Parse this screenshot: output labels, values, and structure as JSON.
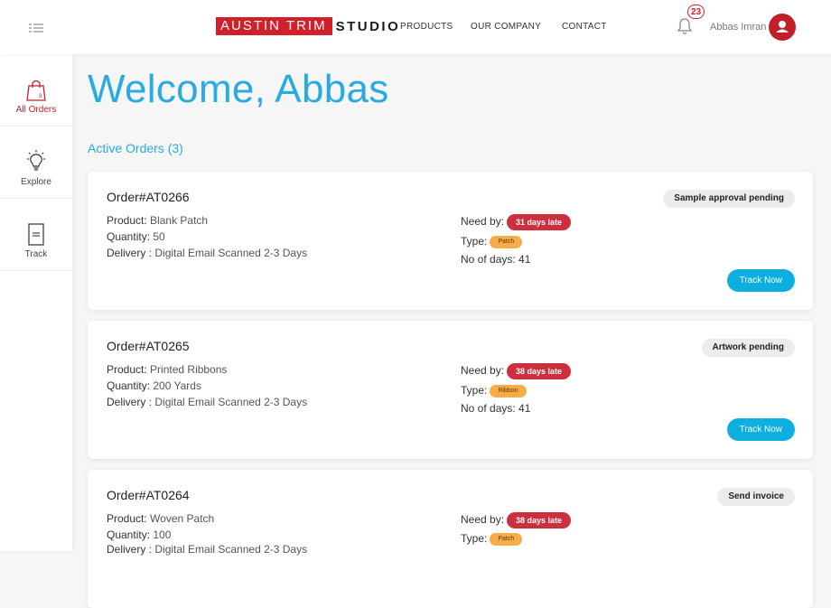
{
  "header": {
    "logo_part1": "AUSTIN TRIM",
    "logo_part2": "STUDIO",
    "nav": [
      "PRODUCTS",
      "OUR COMPANY",
      "CONTACT"
    ],
    "notification_count": "23",
    "user_name": "Abbas Imran",
    "icons": {
      "menu": "menu-icon",
      "bell": "bell-icon",
      "avatar": "user-avatar-icon"
    }
  },
  "sidebar": {
    "items": [
      {
        "label": "All Orders",
        "icon": "shopping-bag-icon",
        "active": true
      },
      {
        "label": "Explore",
        "icon": "lightbulb-icon",
        "active": false
      },
      {
        "label": "Track",
        "icon": "document-icon",
        "active": false
      }
    ]
  },
  "main": {
    "welcome": "Welcome, Abbas",
    "active_orders": "Active Orders (3)"
  },
  "labels": {
    "product": "Product:",
    "quantity": "Quantity:",
    "delivery": "Delivery :",
    "need_by": "Need by:",
    "type": "Type:",
    "no_of_days": "No of days:",
    "track_now": "Track Now"
  },
  "orders": [
    {
      "id": "Order#AT0266",
      "product": "Blank Patch",
      "quantity": "50",
      "delivery": "Digital Email Scanned 2-3 Days",
      "need_by": "31 days late",
      "type": "Patch",
      "days": "41",
      "status": "Sample approval pending"
    },
    {
      "id": "Order#AT0265",
      "product": "Printed Ribbons",
      "quantity": "200 Yards",
      "delivery": "Digital Email Scanned 2-3 Days",
      "need_by": "38 days late",
      "type": "Ribbon",
      "days": "41",
      "status": "Artwork pending"
    },
    {
      "id": "Order#AT0264",
      "product": "Woven Patch",
      "quantity": "100",
      "delivery": "Digital Email Scanned 2-3 Days",
      "need_by": "38 days late",
      "type": "Patch",
      "days": "",
      "status": "Send invoice"
    }
  ],
  "colors": {
    "brand_red": "#d0202a",
    "accent_blue": "#29abe2",
    "button_blue": "#0dafe0",
    "late_red": "#cc2f3d",
    "type_orange": "#f7ac4a"
  }
}
